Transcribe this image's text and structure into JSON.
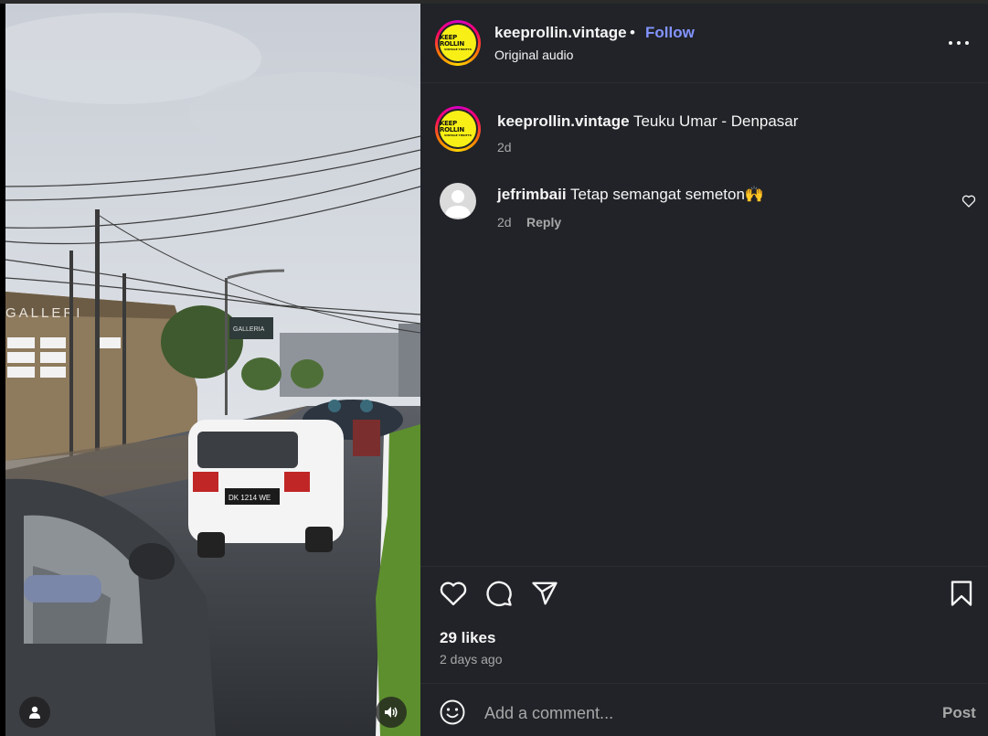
{
  "post": {
    "username": "keeprollin.vintage",
    "separator": "•",
    "follow_label": "Follow",
    "audio": "Original audio",
    "logo_text": "KEEP ROLLIN",
    "logo_subtext": "VINTAGE THRIFTS"
  },
  "caption": {
    "username": "keeprollin.vintage",
    "text": "Teuku Umar - Denpasar",
    "time": "2d"
  },
  "comments": [
    {
      "username": "jefrimbaii",
      "text": "Tetap semangat semeton🙌",
      "time": "2d",
      "reply_label": "Reply"
    }
  ],
  "stats": {
    "likes": "29 likes",
    "posted": "2 days ago"
  },
  "composer": {
    "placeholder": "Add a comment...",
    "post_label": "Post"
  },
  "media": {
    "store_sign": "GALLERI",
    "billboard": "GALLERIA",
    "plate": "DK 1214 WE"
  },
  "colors": {
    "panel_bg": "#212328",
    "follow_blue": "#8394ff",
    "muted_text": "#a8a8a8",
    "logo_yellow": "#f7ef16"
  },
  "icons": [
    "like-icon",
    "comment-icon",
    "share-icon",
    "save-icon",
    "more-icon",
    "emoji-icon",
    "user-tag-icon",
    "speaker-icon",
    "small-heart-icon"
  ]
}
